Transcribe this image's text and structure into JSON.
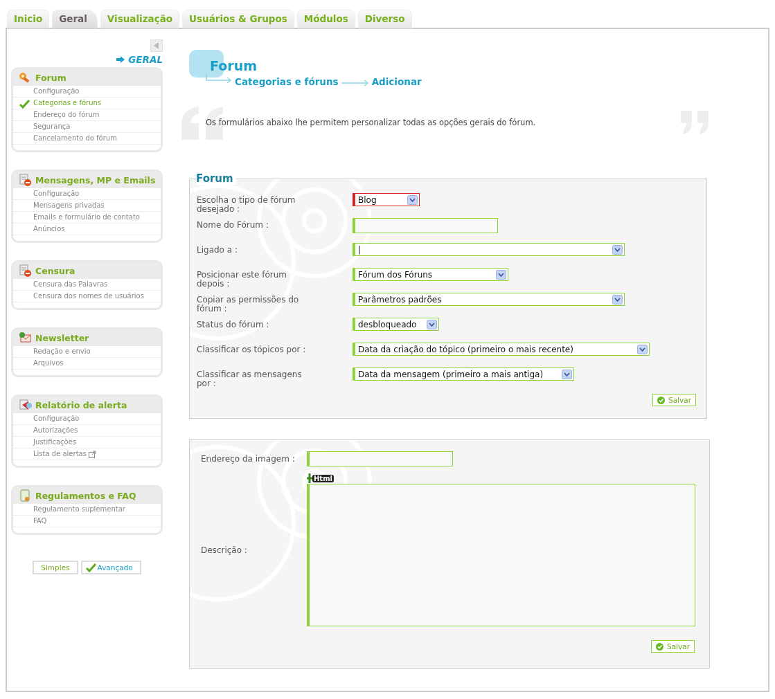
{
  "tabs": [
    {
      "label": "Inicio",
      "selected": false
    },
    {
      "label": "Geral",
      "selected": true
    },
    {
      "label": "Visualização",
      "selected": false
    },
    {
      "label": "Usuários & Grupos",
      "selected": false
    },
    {
      "label": "Módulos",
      "selected": false
    },
    {
      "label": "Diverso",
      "selected": false
    }
  ],
  "sidebar": {
    "section_link": "GERAL",
    "groups": [
      {
        "title": "Forum",
        "items": [
          {
            "label": "Configuração",
            "selected": false
          },
          {
            "label": "Categorias e fóruns",
            "selected": true
          },
          {
            "label": "Endereço do fórum",
            "selected": false
          },
          {
            "label": "Segurança",
            "selected": false
          },
          {
            "label": "Cancelamento do fórum",
            "selected": false
          }
        ]
      },
      {
        "title": "Mensagens, MP e Emails",
        "items": [
          {
            "label": "Configuração",
            "selected": false
          },
          {
            "label": "Mensagens privadas",
            "selected": false
          },
          {
            "label": "Emails e formulário de contato",
            "selected": false
          },
          {
            "label": "Anúncios",
            "selected": false
          }
        ]
      },
      {
        "title": "Censura",
        "items": [
          {
            "label": "Censura das Palavras",
            "selected": false
          },
          {
            "label": "Censura dos nomes de usuários",
            "selected": false
          }
        ]
      },
      {
        "title": "Newsletter",
        "items": [
          {
            "label": "Redação e envio",
            "selected": false
          },
          {
            "label": "Arquivos",
            "selected": false
          }
        ]
      },
      {
        "title": "Relatório de alerta",
        "items": [
          {
            "label": "Configuração",
            "selected": false
          },
          {
            "label": "Autorizações",
            "selected": false
          },
          {
            "label": "Justificações",
            "selected": false
          },
          {
            "label": "Lista de alertas",
            "selected": false,
            "external": true
          }
        ]
      },
      {
        "title": "Regulamentos e FAQ",
        "items": [
          {
            "label": "Regulamento suplementar",
            "selected": false
          },
          {
            "label": "FAQ",
            "selected": false
          }
        ]
      }
    ],
    "mode_buttons": [
      {
        "label": "Simples",
        "selected": false
      },
      {
        "label": "Avançado",
        "selected": true
      }
    ]
  },
  "header": {
    "title": "Forum",
    "breadcrumb": [
      "Categorias e fóruns",
      "Adicionar"
    ],
    "intro": "Os formulários abaixo lhe permitem personalizar todas as opções gerais do fórum."
  },
  "forum_form": {
    "legend": "Forum",
    "fields": [
      {
        "kind": "select",
        "label": "Escolha o tipo de fórum desejado :",
        "value": "Blog",
        "flagged": true
      },
      {
        "kind": "text",
        "label": "Nome do Fórum :",
        "flagged": false
      },
      {
        "kind": "select",
        "label": "Ligado a :",
        "value": "|",
        "flagged": false
      },
      {
        "kind": "select",
        "label": "Posicionar este fórum depois :",
        "value": "Fórum dos Fóruns",
        "flagged": false
      },
      {
        "kind": "select",
        "label": "Copiar as permissões do fórum :",
        "value": "Parâmetros padrões",
        "flagged": false
      },
      {
        "kind": "select",
        "label": "Status do fórum :",
        "value": "desbloqueado",
        "flagged": false
      },
      {
        "kind": "select",
        "label": "Classificar os tópicos por :",
        "value": "Data da criação do tópico (primeiro o mais recente)",
        "flagged": false
      },
      {
        "kind": "select",
        "label": "Classificar as mensagens por :",
        "value": "Data da mensagem (primeiro a mais antiga)",
        "flagged": false
      }
    ],
    "save": "Salvar"
  },
  "image_form": {
    "image_label": "Endereço da imagem :",
    "html_button": "Html",
    "description_label": "Descrição :",
    "save": "Salvar"
  }
}
